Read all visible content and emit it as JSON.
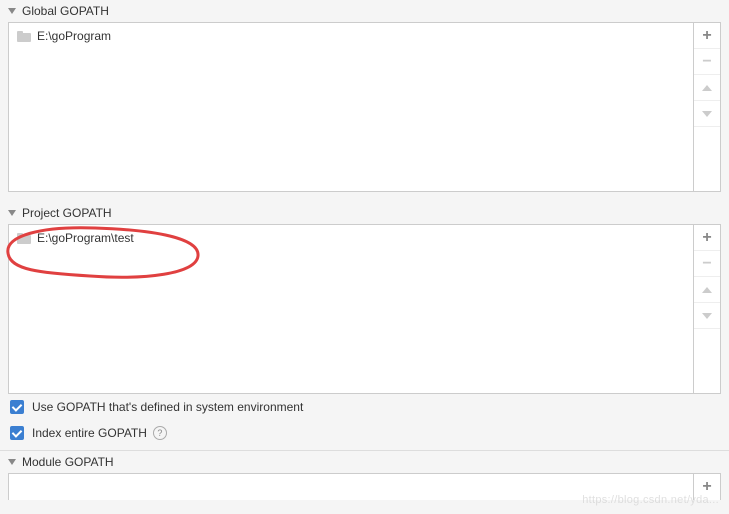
{
  "globalGopath": {
    "title": "Global GOPATH",
    "items": [
      "E:\\goProgram"
    ]
  },
  "projectGopath": {
    "title": "Project GOPATH",
    "items": [
      "E:\\goProgram\\test"
    ]
  },
  "moduleGopath": {
    "title": "Module GOPATH"
  },
  "checkboxes": {
    "useGopath": {
      "label": "Use GOPATH that's defined in system environment",
      "checked": true
    },
    "indexGopath": {
      "label": "Index entire GOPATH",
      "checked": true
    }
  },
  "watermark": "https://blog.csdn.net/yda...",
  "buttons": {
    "add": "+",
    "remove": "−"
  }
}
